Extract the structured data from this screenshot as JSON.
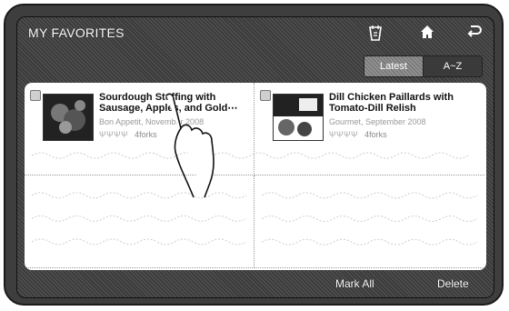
{
  "header": {
    "title": "MY FAVORITES",
    "icons": [
      "shopping-list-icon",
      "home-icon",
      "back-icon"
    ]
  },
  "sort_tabs": [
    {
      "label": "Latest",
      "active": true
    },
    {
      "label": "A~Z",
      "active": false
    }
  ],
  "favorites": [
    {
      "title": "Sourdough Stuffing with Sausage, Apples, and Gold⋯",
      "source": "Bon Appetit, November 2008",
      "rating_label": "4forks",
      "forks": 4
    },
    {
      "title": "Dill Chicken Paillards with Tomato-Dill Relish",
      "source": "Gourmet, September 2008",
      "rating_label": "4forks",
      "forks": 4
    }
  ],
  "footer": {
    "mark_all_label": "Mark All",
    "delete_label": "Delete"
  }
}
